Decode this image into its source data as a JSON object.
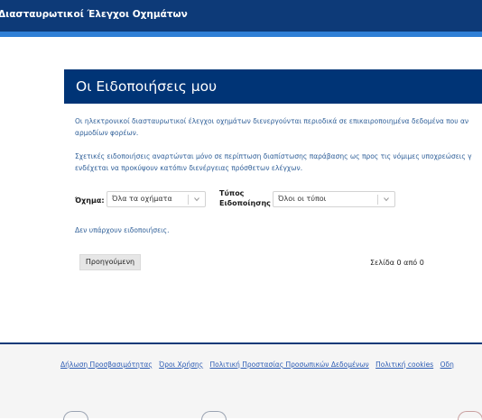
{
  "header": {
    "title": "Διασταυρωτικοί Έλεγχοι Οχημάτων"
  },
  "page": {
    "title": "Οι Ειδοποιήσεις μου",
    "paragraph1": {
      "line1": "Οι ηλεκτρονικοί διασταυρωτικοί έλεγχοι οχημάτων διενεργούνται περιοδικά σε επικαιροποιημένα δεδομένα που αν",
      "line2": "αρμοδίων φορέων."
    },
    "paragraph2": {
      "line1": "Σχετικές ειδοποιήσεις αναρτώνται μόνο σε περίπτωση διαπίστωσης παράβασης ως προς τις νόμιμες υποχρεώσεις γ",
      "line2": "ενδέχεται να προκύψουν κατόπιν διενέργειας πρόσθετων ελέγχων."
    }
  },
  "filters": {
    "vehicle_label": "Όχημα:",
    "vehicle_value": "Όλα τα οχήματα",
    "type_label_line1": "Τύπος",
    "type_label_line2": "Ειδοποίησης",
    "type_value": "Όλοι οι τύποι"
  },
  "results": {
    "empty_message": "Δεν υπάρχουν ειδοποιήσεις."
  },
  "pagination": {
    "prev_label": "Προηγούμενη",
    "page_info": "Σελίδα 0 από 0"
  },
  "footer": {
    "links": [
      "Δήλωση Προσβασιμότητας",
      "Όροι Χρήσης",
      "Πολιτική Προστασίας Προσωπικών Δεδομένων",
      "Πολιτική cookies",
      "Οδη"
    ]
  },
  "colors": {
    "header_bg": "#0d3a78",
    "accent": "#2f7fd6",
    "title_bar": "#003476",
    "link": "#2a5ab3"
  }
}
